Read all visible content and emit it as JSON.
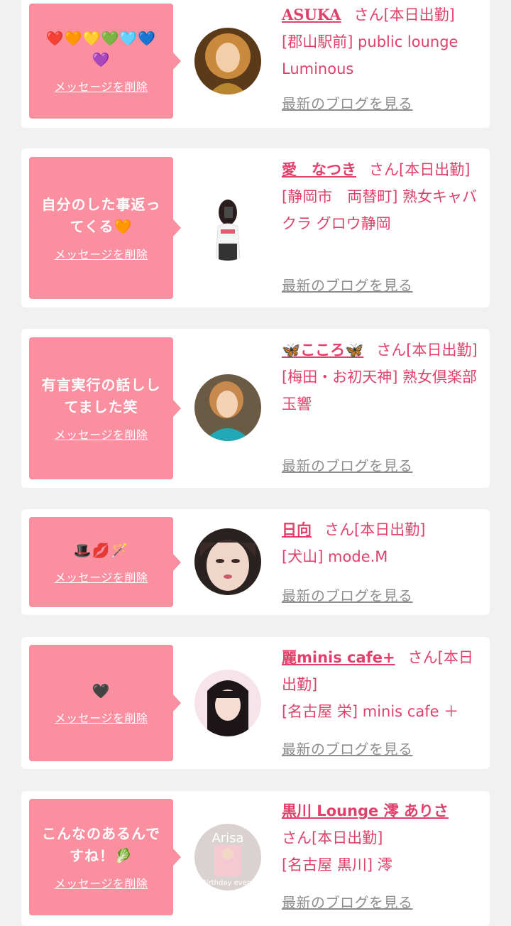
{
  "delete_label": "メッセージを削除",
  "blog_label": "最新のブログを見る",
  "accent_color": "#fa8fa0",
  "text_color": "#e0406a",
  "cards": [
    {
      "message": "❤️🧡💛💚🩵💙💜",
      "name": "ASUKA",
      "suffix": "さん[本日出勤]",
      "shop": "[郡山駅前] public lounge Luminous"
    },
    {
      "message": "自分のした事返ってくる🧡",
      "name": "愛　なつき",
      "suffix": "さん[本日出勤]",
      "shop": "[静岡市　両替町] 熟女キャバクラ グロウ静岡"
    },
    {
      "message": "有言実行の話ししてました笑",
      "name": "🦋こころ🦋",
      "suffix": "さん[本日出勤]",
      "shop": "[梅田・お初天神] 熟女倶楽部 玉響"
    },
    {
      "message": "🎩💋🪄",
      "name": "日向",
      "suffix": "さん[本日出勤]",
      "shop": "[犬山] mode.M"
    },
    {
      "message": "🖤",
      "name": "麗minis cafe+",
      "suffix": "さん[本日出勤]",
      "shop": "[名古屋 栄] minis cafe ＋"
    },
    {
      "message": "こんなのあるんですね！🥬",
      "name": "黒川 Lounge 澪 ありさ",
      "suffix": "さん[本日出勤]",
      "shop": "[名古屋 黒川] 澪",
      "avatar_text": "Arisa",
      "avatar_subtext": "Birthday event"
    }
  ]
}
